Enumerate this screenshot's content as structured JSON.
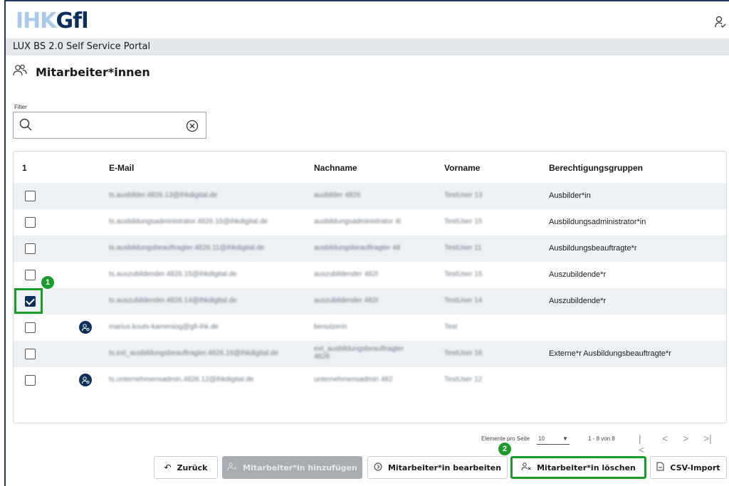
{
  "brand": {
    "logo_part1": "IHK",
    "logo_part2": "Gfl"
  },
  "portal": {
    "title": "LUX BS 2.0 Self Service Portal"
  },
  "page": {
    "title": "Mitarbeiter*innen"
  },
  "filter": {
    "label": "Filter",
    "value": ""
  },
  "table": {
    "selected_count": "1",
    "columns": [
      "E-Mail",
      "Nachname",
      "Vorname",
      "Berechtigungsgruppen"
    ],
    "rows": [
      {
        "checked": false,
        "avatar": false,
        "email": "ts.ausbilder.4826.13@ihkdigital.de",
        "nachname": "ausbilder 4826",
        "vorname": "TestUser 13",
        "gruppe": "Ausbilder*in"
      },
      {
        "checked": false,
        "avatar": false,
        "email": "ts.ausbildungsadministrator.4826.15@ihkdigital.de",
        "nachname": "ausbildungsadministrator 4826",
        "vorname": "TestUser 15",
        "gruppe": "Ausbildungsadministrator*in"
      },
      {
        "checked": false,
        "avatar": false,
        "email": "ts.ausbildungsbeauftragter.4826.11@ihkdigital.de",
        "nachname": "ausbildungsbeauftragter 4826",
        "vorname": "TestUser 11",
        "gruppe": "Ausbildungsbeauftragte*r"
      },
      {
        "checked": false,
        "avatar": false,
        "email": "ts.auszubildender.4826.15@ihkdigital.de",
        "nachname": "auszubildender 4826",
        "vorname": "TestUser 15",
        "gruppe": "Auszubildende*r"
      },
      {
        "checked": true,
        "avatar": false,
        "email": "ts.auszubildender.4826.14@ihkdigital.de",
        "nachname": "auszubildender 4826",
        "vorname": "TestUser 14",
        "gruppe": "Auszubildende*r"
      },
      {
        "checked": false,
        "avatar": true,
        "email": "marius.kouts-kameniog@gfi-ihk.de",
        "nachname": "benutzerin",
        "vorname": "Test",
        "gruppe": ""
      },
      {
        "checked": false,
        "avatar": false,
        "email": "ts.ext_ausbildungsbeauftragter.4826.16@ihkdigital.de",
        "nachname": "ext_ausbildungsbeauftragter 4826",
        "vorname": "TestUser 16",
        "gruppe": "Externe*r Ausbildungsbeauftragte*r"
      },
      {
        "checked": false,
        "avatar": true,
        "email": "ts.unternehmensadmin.4826.12@ihkdigital.de",
        "nachname": "unternehmensadmin 4826",
        "vorname": "TestUser 12",
        "gruppe": ""
      }
    ]
  },
  "pagination": {
    "per_page_label": "Elemente pro Seite",
    "per_page_value": "10",
    "range": "1 - 8 von 8"
  },
  "buttons": {
    "back": "Zurück",
    "add": "Mitarbeiter*in hinzufügen",
    "edit": "Mitarbeiter*in bearbeiten",
    "delete": "Mitarbeiter*in löschen",
    "csv": "CSV-Import"
  },
  "annotations": {
    "badge1": "1",
    "badge2": "2"
  },
  "colors": {
    "primary": "#0b2f5a",
    "highlight": "#1a9b2a",
    "row_alt": "#eef1f4"
  }
}
